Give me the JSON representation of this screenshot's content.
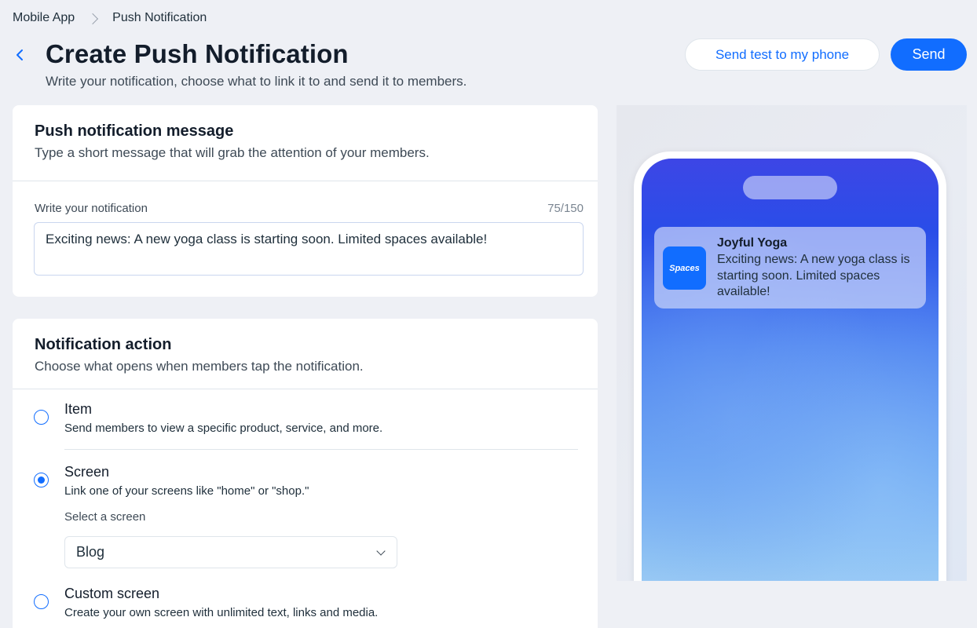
{
  "breadcrumb": {
    "parent": "Mobile App",
    "current": "Push Notification"
  },
  "header": {
    "title": "Create Push Notification",
    "subtitle": "Write your notification, choose what to link it to and send it to members.",
    "test_button": "Send test to my phone",
    "send_button": "Send"
  },
  "message_card": {
    "title": "Push notification message",
    "subtitle": "Type a short message that will grab the attention of your members.",
    "field_label": "Write your notification",
    "char_count": "75/150",
    "value": "Exciting news: A new yoga class is starting soon. Limited spaces available!"
  },
  "action_card": {
    "title": "Notification action",
    "subtitle": "Choose what opens when members tap the notification.",
    "options": [
      {
        "title": "Item",
        "desc": "Send members to view a specific product, service, and more.",
        "checked": false
      },
      {
        "title": "Screen",
        "desc": "Link one of your screens like \"home\" or \"shop.\"",
        "checked": true
      },
      {
        "title": "Custom screen",
        "desc": "Create your own screen with unlimited text, links and media.",
        "checked": false
      }
    ],
    "select_label": "Select a screen",
    "select_value": "Blog"
  },
  "preview": {
    "app_icon_text": "Spaces",
    "notif_title": "Joyful Yoga",
    "notif_body": "Exciting news: A new yoga class is starting soon. Limited spaces available!"
  },
  "colors": {
    "accent": "#116dff",
    "background": "#eef0f5"
  }
}
